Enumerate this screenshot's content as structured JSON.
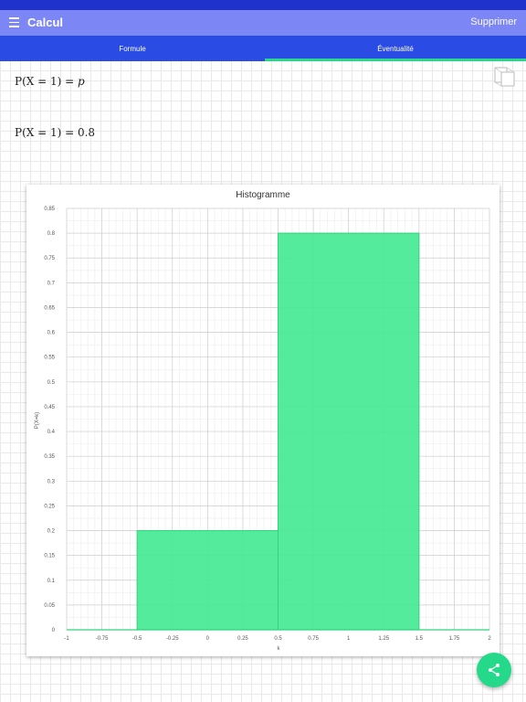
{
  "app": {
    "title": "Calcul",
    "delete_label": "Supprimer"
  },
  "tabs": [
    {
      "label": "Formule",
      "active": false
    },
    {
      "label": "Éventualité",
      "active": true
    }
  ],
  "formulas": {
    "f1_lhs": "P(X = 1) = ",
    "f1_rhs": "p",
    "f2_lhs": "P(X = 1) = ",
    "f2_rhs": "0.8"
  },
  "icons": {
    "menu": "menu-icon",
    "copy": "copy-icon",
    "share": "share-icon"
  },
  "colors": {
    "status_bar": "#1f33cc",
    "app_bar": "#7c87f5",
    "tab_bar": "#2a4ce4",
    "accent": "#25d98a",
    "bar_fill": "#45ea94"
  },
  "chart_data": {
    "type": "bar",
    "title": "Histogramme",
    "xlabel": "k",
    "ylabel": "P(X=k)",
    "xlim": [
      -1,
      2
    ],
    "ylim": [
      0,
      0.85
    ],
    "xticks": [
      -1,
      -0.75,
      -0.5,
      -0.25,
      0,
      0.25,
      0.5,
      0.75,
      1,
      1.25,
      1.5,
      1.75,
      2
    ],
    "yticks": [
      0,
      0.05,
      0.1,
      0.15,
      0.2,
      0.25,
      0.3,
      0.35,
      0.4,
      0.45,
      0.5,
      0.55,
      0.6,
      0.65,
      0.7,
      0.75,
      0.8,
      0.85
    ],
    "bars": [
      {
        "k": 0,
        "x_start": -0.5,
        "x_end": 0.5,
        "value": 0.2
      },
      {
        "k": 1,
        "x_start": 0.5,
        "x_end": 1.5,
        "value": 0.8
      }
    ],
    "grid": true
  }
}
